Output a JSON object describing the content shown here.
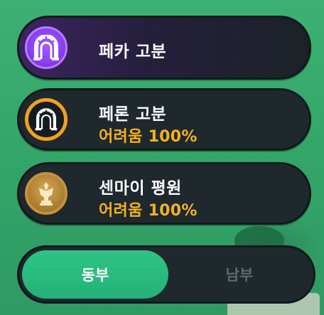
{
  "locations": [
    {
      "name": "페카 고분",
      "difficulty": "",
      "icon": "tomb-arch-icon",
      "selected": true
    },
    {
      "name": "페론 고분",
      "difficulty": "어려움 100%",
      "icon": "tomb-arch-icon",
      "selected": false
    },
    {
      "name": "센마이 평원",
      "difficulty": "어려움 100%",
      "icon": "guardian-statue-icon",
      "selected": false
    }
  ],
  "region_toggle": {
    "options": [
      "동부",
      "남부"
    ],
    "selected": "동부"
  },
  "colors": {
    "accent_green": "#2ec487",
    "difficulty_gold": "#f3b21d",
    "selected_purple": "#8a3ff2"
  }
}
